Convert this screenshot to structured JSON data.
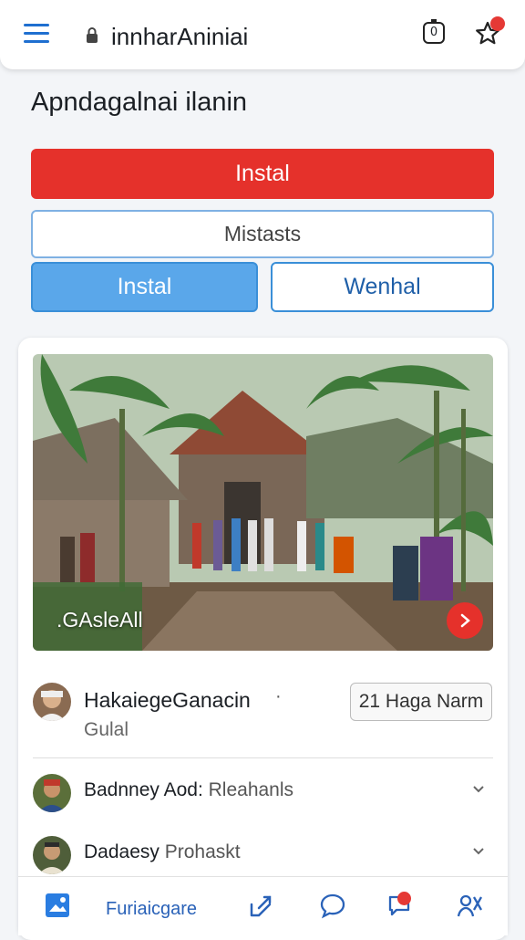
{
  "topbar": {
    "url": "innharAniniai",
    "tabs_count": "0",
    "icons": [
      "menu-icon",
      "lock-icon",
      "tabs-icon",
      "star-icon"
    ]
  },
  "page": {
    "title": "Apndagalnai ilanin"
  },
  "buttons": {
    "primary": "Instal",
    "secondary": "Mistasts",
    "left": "Instal",
    "right": "Wenhal"
  },
  "card": {
    "photo_caption": ".GAsleAll",
    "item1": {
      "name": "HakaiegeGanacin",
      "dot": "·",
      "sub": "Gulal",
      "badge": "21 Haga Narm"
    },
    "item2": {
      "label": "Badnney Aod:",
      "label_muted": "Rleahanls"
    },
    "item3": {
      "label": "Dadaesy",
      "label_muted": "Prohaskt"
    }
  },
  "bottom_nav": {
    "label": "Furiaicgare",
    "accent_color": "#2a62b8"
  },
  "colors": {
    "red": "#e5312b",
    "blue": "#3a8fd8"
  }
}
